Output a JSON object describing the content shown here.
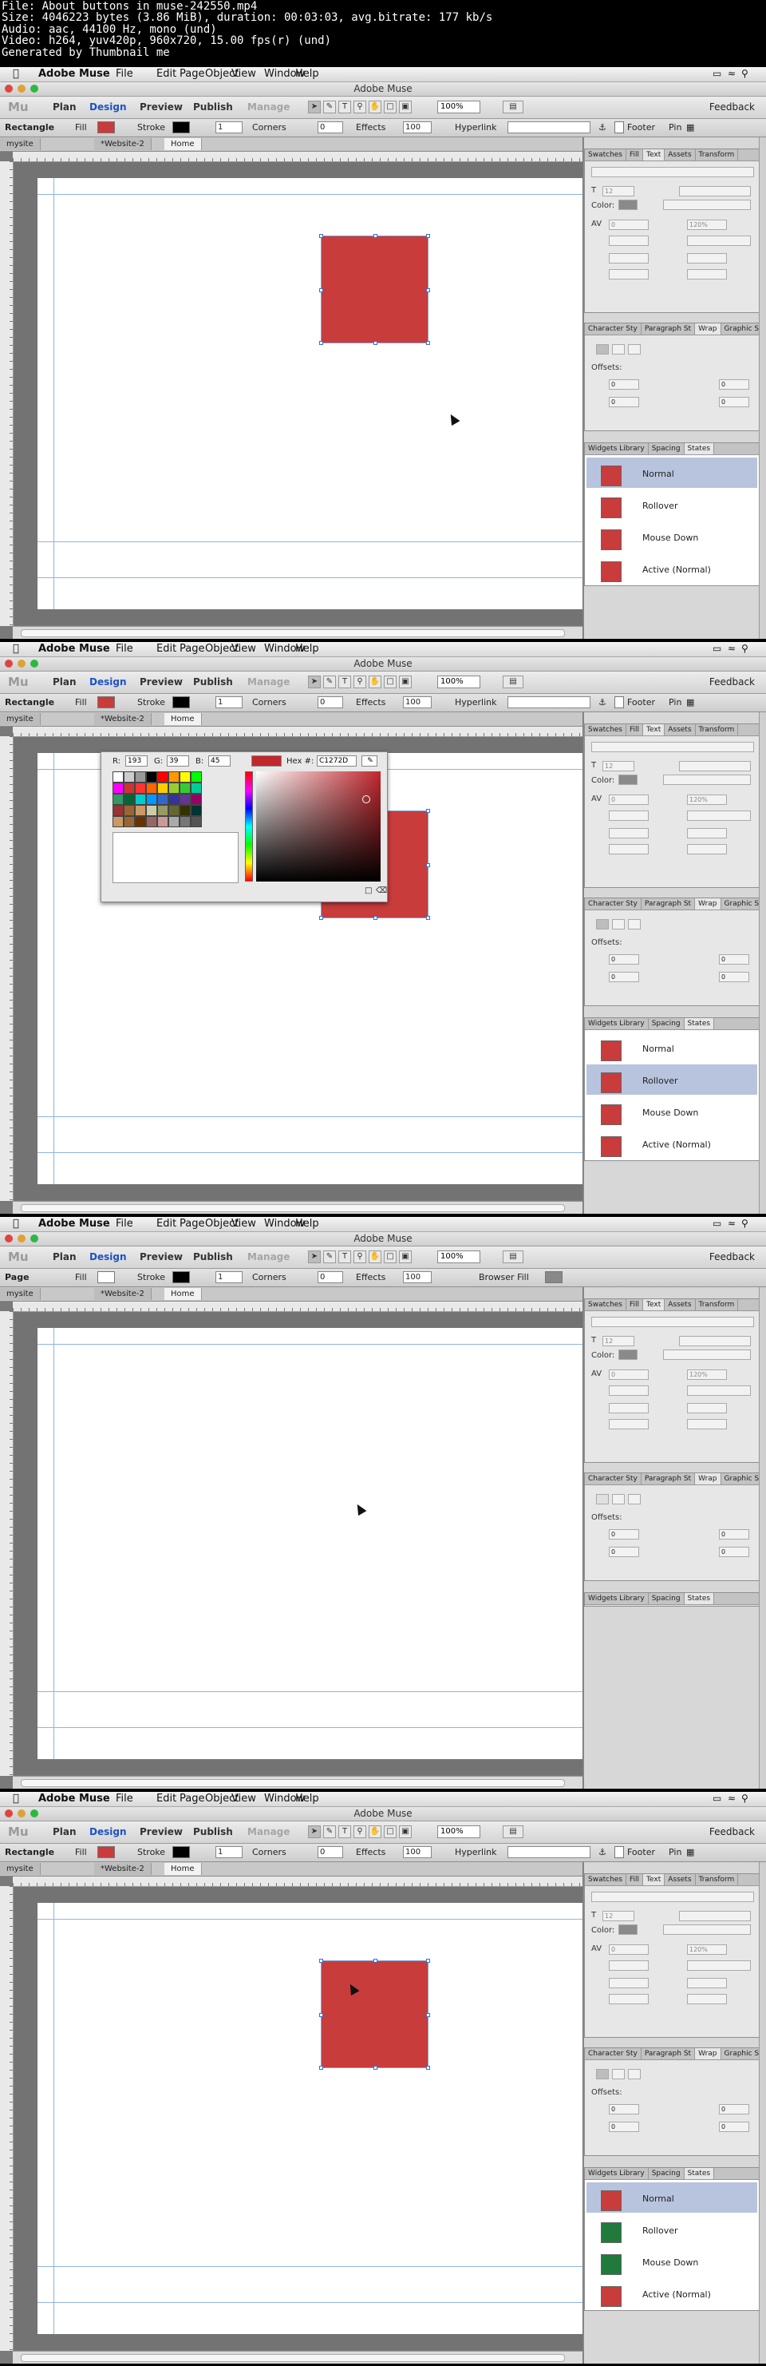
{
  "file_info": {
    "line1": "File: About buttons in muse-242550.mp4",
    "line2": "Size: 4046223 bytes (3.86 MiB), duration: 00:03:03, avg.bitrate: 177 kb/s",
    "line3": "Audio: aac, 44100 Hz, mono (und)",
    "line4": "Video: h264, yuv420p, 960x720, 15.00 fps(r) (und)",
    "line5": "Generated by Thumbnail me"
  },
  "menubar": {
    "app": "Adobe Muse",
    "items": [
      "File",
      "Edit",
      "Page",
      "Object",
      "View",
      "Window",
      "Help"
    ]
  },
  "window_title": "Adobe Muse",
  "modes": {
    "logo": "Mu",
    "plan": "Plan",
    "design": "Design",
    "preview": "Preview",
    "publish": "Publish",
    "manage": "Manage",
    "zoom": "100%",
    "feedback": "Feedback"
  },
  "control": {
    "selection_rect": "Rectangle",
    "selection_page": "Page",
    "fill": "Fill",
    "stroke": "Stroke",
    "stroke_value": "1",
    "corners": "Corners",
    "corners_value": "0",
    "effects": "Effects",
    "opacity": "100",
    "hyperlink": "Hyperlink",
    "browser_fill": "Browser Fill",
    "footer": "Footer",
    "pin": "Pin"
  },
  "colors": {
    "accent": "#1c52c4",
    "red_fill": "#c83c3c",
    "green_fill": "#1f7a3c",
    "selected_row": "#b8c4dd"
  },
  "tabs": {
    "site": "mysite",
    "site2": "*Website-2",
    "home": "Home"
  },
  "panels": {
    "top_tabs": [
      "Swatches",
      "Fill",
      "Text",
      "Assets",
      "Transform"
    ],
    "color_label": "Color:",
    "text_size": "12",
    "line_height": "120%",
    "mid_tabs": [
      "Character Sty",
      "Paragraph St",
      "Wrap",
      "Graphic Style"
    ],
    "offsets_label": "Offsets:",
    "offset_value": "0",
    "bottom_tabs": [
      "Widgets Library",
      "Spacing",
      "States"
    ]
  },
  "states": {
    "normal": "Normal",
    "rollover": "Rollover",
    "mouse_down": "Mouse Down",
    "active": "Active (Normal)"
  },
  "color_picker": {
    "r_label": "R:",
    "r": "193",
    "g_label": "G:",
    "g": "39",
    "b_label": "B:",
    "b": "45",
    "hex_label": "Hex #:",
    "hex": "C1272D"
  }
}
